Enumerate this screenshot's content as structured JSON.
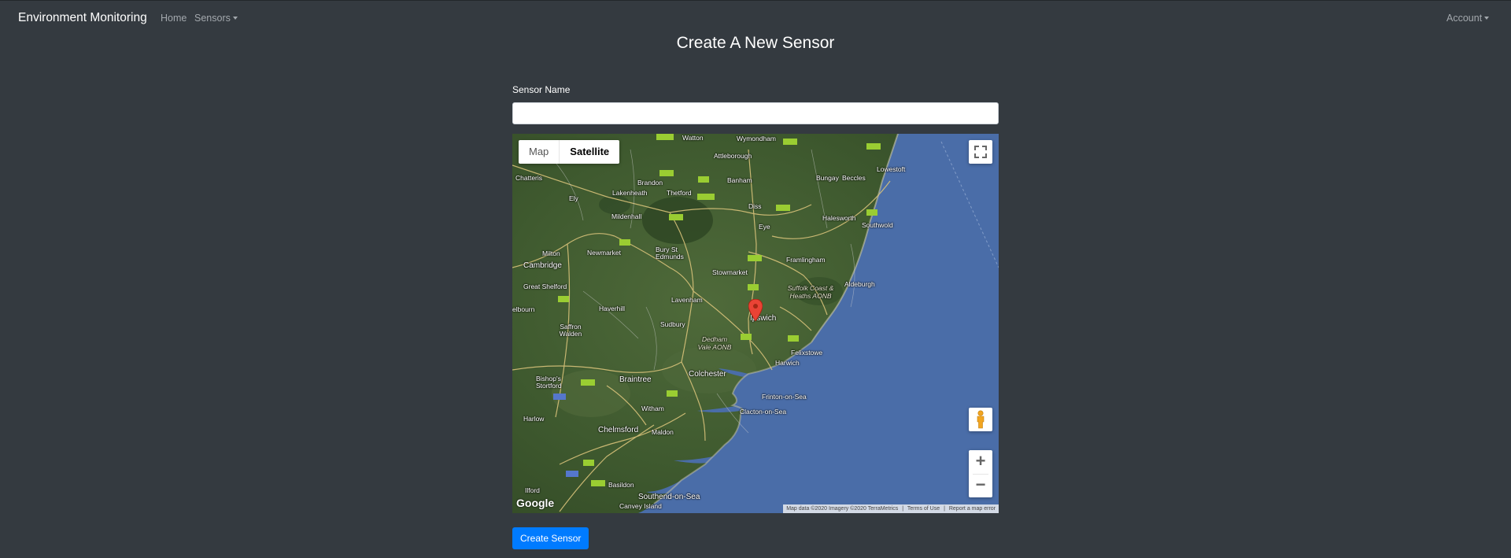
{
  "navbar": {
    "brand": "Environment Monitoring",
    "links": [
      {
        "label": "Home"
      },
      {
        "label": "Sensors"
      }
    ],
    "account": "Account"
  },
  "page": {
    "title": "Create A New Sensor"
  },
  "form": {
    "sensor_name_label": "Sensor Name",
    "sensor_name_value": "",
    "submit_label": "Create Sensor"
  },
  "map": {
    "type_map": "Map",
    "type_satellite": "Satellite",
    "selected_type": "Satellite",
    "logo": "Google",
    "attribution": {
      "data": "Map data ©2020 Imagery ©2020 TerraMetrics",
      "terms": "Terms of Use",
      "report": "Report a map error"
    },
    "marker_place": "Ipswich",
    "labels": [
      {
        "text": "Watton"
      },
      {
        "text": "Wymondham"
      },
      {
        "text": "Attleborough"
      },
      {
        "text": "Chatteris"
      },
      {
        "text": "Brandon"
      },
      {
        "text": "Banham"
      },
      {
        "text": "Bungay"
      },
      {
        "text": "Beccles"
      },
      {
        "text": "Lowestoft"
      },
      {
        "text": "Lakenheath"
      },
      {
        "text": "Thetford"
      },
      {
        "text": "Ely"
      },
      {
        "text": "Mildenhall"
      },
      {
        "text": "Diss"
      },
      {
        "text": "Halesworth"
      },
      {
        "text": "Southwold"
      },
      {
        "text": "Eye"
      },
      {
        "text": "Milton"
      },
      {
        "text": "Newmarket"
      },
      {
        "text": "Bury St Edmunds"
      },
      {
        "text": "Cambridge"
      },
      {
        "text": "Framlingham"
      },
      {
        "text": "Stowmarket"
      },
      {
        "text": "Great Shelford"
      },
      {
        "text": "Aldeburgh"
      },
      {
        "text": "Suffolk Coast & Heaths AONB"
      },
      {
        "text": "Haverhill"
      },
      {
        "text": "Lavenham"
      },
      {
        "text": "Saffron Walden"
      },
      {
        "text": "Ipswich"
      },
      {
        "text": "Sudbury"
      },
      {
        "text": "Dedham Vale AONB"
      },
      {
        "text": "Felixstowe"
      },
      {
        "text": "Harwich"
      },
      {
        "text": "Colchester"
      },
      {
        "text": "Bishop's Stortford"
      },
      {
        "text": "Braintree"
      },
      {
        "text": "Frinton-on-Sea"
      },
      {
        "text": "Witham"
      },
      {
        "text": "Clacton-on-Sea"
      },
      {
        "text": "Harlow"
      },
      {
        "text": "Chelmsford"
      },
      {
        "text": "Maldon"
      },
      {
        "text": "Basildon"
      },
      {
        "text": "Southend-on-Sea"
      },
      {
        "text": "Canvey Island"
      },
      {
        "text": "Ilford"
      },
      {
        "text": "elbourn"
      }
    ]
  },
  "colors": {
    "background": "#343a40",
    "primary": "#007bff",
    "sea": "#4a6da8",
    "marker": "#ea4335"
  },
  "icons": {
    "fullscreen": "fullscreen-icon",
    "pegman": "pegman-icon",
    "marker": "map-marker-icon"
  }
}
